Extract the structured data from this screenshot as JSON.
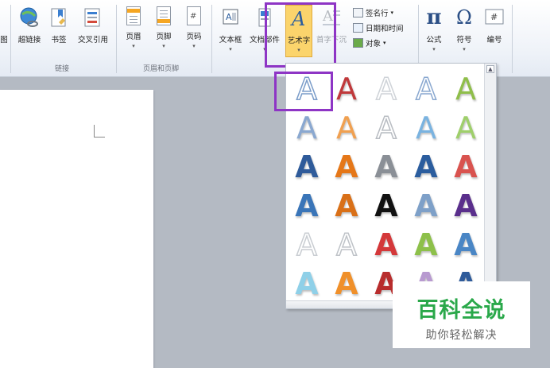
{
  "ribbon": {
    "truncated_left": "图",
    "buttons": {
      "hyperlink": "超链接",
      "bookmark": "书签",
      "cross_reference": "交叉引用",
      "header": "页眉",
      "footer": "页脚",
      "page_number": "页码",
      "text_box": "文本框",
      "quick_parts": "文档部件",
      "wordart": "艺术字",
      "drop_cap": "首字下沉",
      "signature_line": "签名行",
      "date_time": "日期和时间",
      "object": "对象",
      "equation": "公式",
      "symbol": "符号",
      "number": "编号"
    },
    "groups": {
      "links": "链接",
      "header_footer": "页眉和页脚"
    }
  },
  "gallery": {
    "letter": "A",
    "styles": [
      [
        "#7a9cc9",
        "#c0393b",
        "#cfd3d8",
        "#8aa8d0",
        "#8fbe4a"
      ],
      [
        "#8aa8d0",
        "#f0a050",
        "#b8bcc2",
        "#7ab3e0",
        "#9fcf6b"
      ],
      [
        "#2f5b9a",
        "#e57718",
        "#8a8f96",
        "#2b5d9e",
        "#d9534f"
      ],
      [
        "#3a75b8",
        "#d97018",
        "#111111",
        "#7ea0c8",
        "#5a2f8c"
      ],
      [
        "#c9cdd2",
        "#bfc3c8",
        "#d4383a",
        "#8dc04a",
        "#4a86c5"
      ],
      [
        "#8fd0e8",
        "#f0902a",
        "#b82d2d",
        "#b89ad0",
        "#2f5b9a"
      ]
    ]
  },
  "watermark": {
    "title": "百科全说",
    "subtitle": "助你轻松解决"
  },
  "colors": {
    "highlight": "#8e35c5",
    "wordart_active": "#fbd46c"
  }
}
